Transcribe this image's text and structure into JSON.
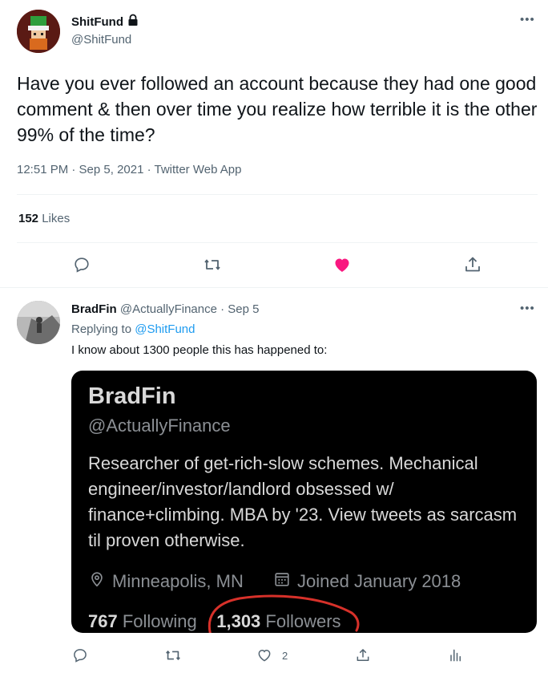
{
  "main_tweet": {
    "author_name": "ShitFund",
    "author_handle": "@ShitFund",
    "text": "Have you ever followed an account because they had one good comment & then over time you realize how terrible it is the other 99% of the time?",
    "timestamp": "12:51 PM · Sep 5, 2021 · Twitter Web App",
    "likes_count": "152",
    "likes_label": "Likes",
    "actions": [
      "reply-icon",
      "retweet-icon",
      "like-icon-filled",
      "share-icon"
    ],
    "like_color": "#f91880"
  },
  "reply": {
    "author_name": "BradFin",
    "author_handle": "@ActuallyFinance",
    "date": "· Sep 5",
    "replying_prefix": "Replying to",
    "replying_to": "@ShitFund",
    "text": "I know about 1300 people this has happened to:",
    "like_count": "2",
    "actions": [
      "reply-icon",
      "retweet-icon",
      "like-icon",
      "share-icon",
      "analytics-icon"
    ]
  },
  "card": {
    "name": "BradFin",
    "handle": "@ActuallyFinance",
    "bio": "Researcher of get-rich-slow schemes. Mechanical engineer/investor/landlord obsessed w/ finance+climbing. MBA by '23. View tweets as sarcasm til proven otherwise.",
    "location": "Minneapolis, MN",
    "joined": "Joined January 2018",
    "following_count": "767",
    "following_label": "Following",
    "followers_count": "1,303",
    "followers_label": "Followers",
    "annotation_color": "#d7312a"
  },
  "colors": {
    "text_primary": "#0f1419",
    "text_secondary": "#536471",
    "link": "#1d9bf0",
    "divider": "#eff3f4"
  }
}
